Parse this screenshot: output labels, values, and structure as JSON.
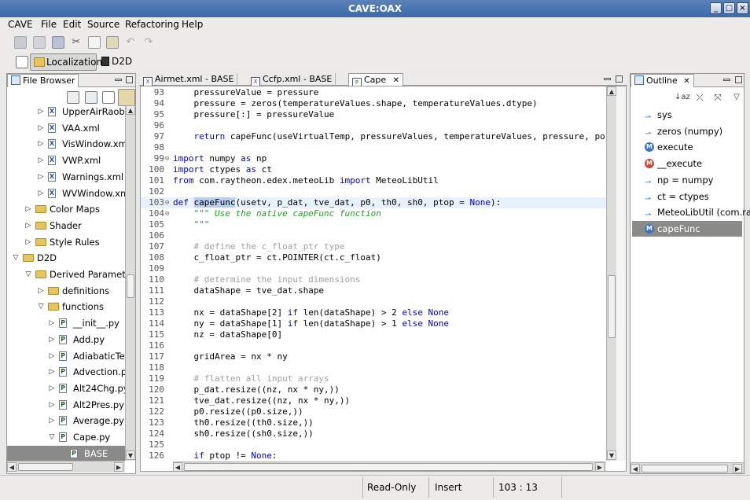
{
  "window": {
    "title": "CAVE:OAX"
  },
  "menu": [
    {
      "label": "CAVE"
    },
    {
      "label": "File"
    },
    {
      "label": "Edit"
    },
    {
      "label": "Source"
    },
    {
      "label": "Refactoring"
    },
    {
      "label": "Help"
    }
  ],
  "perspective": {
    "localization_label": "Localization",
    "d2d_label": "D2D"
  },
  "file_browser": {
    "tab_label": "File Browser",
    "rows": [
      {
        "label": "UpperAirRaob.x",
        "kind": "file",
        "depth": 3,
        "arrow": "right"
      },
      {
        "label": "VAA.xml",
        "kind": "file",
        "depth": 3,
        "arrow": "right"
      },
      {
        "label": "VisWindow.xml",
        "kind": "file",
        "depth": 3,
        "arrow": "right"
      },
      {
        "label": "VWP.xml",
        "kind": "file",
        "depth": 3,
        "arrow": "right"
      },
      {
        "label": "Warnings.xml",
        "kind": "file",
        "depth": 3,
        "arrow": "right"
      },
      {
        "label": "WVWindow.xml",
        "kind": "file",
        "depth": 3,
        "arrow": "right"
      },
      {
        "label": "Color Maps",
        "kind": "folder",
        "depth": 2,
        "arrow": "right"
      },
      {
        "label": "Shader",
        "kind": "folder",
        "depth": 2,
        "arrow": "right"
      },
      {
        "label": "Style Rules",
        "kind": "folder",
        "depth": 2,
        "arrow": "right"
      },
      {
        "label": "D2D",
        "kind": "folder",
        "depth": 1,
        "arrow": "down"
      },
      {
        "label": "Derived Parameter",
        "kind": "folder",
        "depth": 2,
        "arrow": "down"
      },
      {
        "label": "definitions",
        "kind": "folder",
        "depth": 3,
        "arrow": "right"
      },
      {
        "label": "functions",
        "kind": "folder",
        "depth": 3,
        "arrow": "down"
      },
      {
        "label": "__init__.py",
        "kind": "pyfile",
        "depth": 4,
        "arrow": "right"
      },
      {
        "label": "Add.py",
        "kind": "pyfile",
        "depth": 4,
        "arrow": "right"
      },
      {
        "label": "AdiabaticTem",
        "kind": "pyfile",
        "depth": 4,
        "arrow": "right"
      },
      {
        "label": "Advection.py",
        "kind": "pyfile",
        "depth": 4,
        "arrow": "right"
      },
      {
        "label": "Alt24Chg.py",
        "kind": "pyfile",
        "depth": 4,
        "arrow": "right"
      },
      {
        "label": "Alt2Pres.py",
        "kind": "pyfile",
        "depth": 4,
        "arrow": "right"
      },
      {
        "label": "Average.py",
        "kind": "pyfile",
        "depth": 4,
        "arrow": "right"
      },
      {
        "label": "Cape.py",
        "kind": "pyfile",
        "depth": 4,
        "arrow": "down"
      },
      {
        "label": "BASE",
        "kind": "pyfile",
        "depth": 5,
        "arrow": "",
        "selected": true
      }
    ]
  },
  "editor_tabs": [
    {
      "label": "Airmet.xml - BASE",
      "icon": "xml"
    },
    {
      "label": "Ccfp.xml - BASE",
      "icon": "xml"
    },
    {
      "label": "Cape",
      "icon": "py",
      "active": true
    }
  ],
  "code": {
    "lines": [
      {
        "n": "93",
        "t": "    pressureValue = pressure"
      },
      {
        "n": "94",
        "t": "    pressure = zeros(temperatureValues.shape, temperatureValues.dtype)"
      },
      {
        "n": "95",
        "t": "    pressure[:] = pressureValue"
      },
      {
        "n": "96",
        "t": ""
      },
      {
        "n": "97",
        "t": "    return capeFunc(useVirtualTemp, pressureValues, temperatureValues, pressure, po"
      },
      {
        "n": "98",
        "t": ""
      },
      {
        "n": "99",
        "t": "import numpy as np",
        "fold": true
      },
      {
        "n": "100",
        "t": "import ctypes as ct"
      },
      {
        "n": "101",
        "t": "from com.raytheon.edex.meteoLib import MeteoLibUtil"
      },
      {
        "n": "102",
        "t": ""
      },
      {
        "n": "103",
        "t": "def capeFunc(usetv, p_dat, tve_dat, p0, th0, sh0, ptop = None):",
        "fold": true,
        "current": true
      },
      {
        "n": "104",
        "t": "    \"\"\" Use the native capeFunc function",
        "fold": true
      },
      {
        "n": "105",
        "t": "    \"\"\""
      },
      {
        "n": "106",
        "t": ""
      },
      {
        "n": "107",
        "t": "    # define the c_float_ptr type"
      },
      {
        "n": "108",
        "t": "    c_float_ptr = ct.POINTER(ct.c_float)"
      },
      {
        "n": "109",
        "t": ""
      },
      {
        "n": "110",
        "t": "    # determine the input dimensions"
      },
      {
        "n": "111",
        "t": "    dataShape = tve_dat.shape"
      },
      {
        "n": "112",
        "t": ""
      },
      {
        "n": "113",
        "t": "    nx = dataShape[2] if len(dataShape) > 2 else None"
      },
      {
        "n": "114",
        "t": "    ny = dataShape[1] if len(dataShape) > 1 else None"
      },
      {
        "n": "115",
        "t": "    nz = dataShape[0]"
      },
      {
        "n": "116",
        "t": ""
      },
      {
        "n": "117",
        "t": "    gridArea = nx * ny"
      },
      {
        "n": "118",
        "t": ""
      },
      {
        "n": "119",
        "t": "    # flatten all input arrays"
      },
      {
        "n": "120",
        "t": "    p_dat.resize((nz, nx * ny,))"
      },
      {
        "n": "121",
        "t": "    tve_dat.resize((nz, nx * ny,))"
      },
      {
        "n": "122",
        "t": "    p0.resize((p0.size,))"
      },
      {
        "n": "123",
        "t": "    th0.resize((th0.size,))"
      },
      {
        "n": "124",
        "t": "    sh0.resize((sh0.size,))"
      },
      {
        "n": "125",
        "t": ""
      },
      {
        "n": "126",
        "t": "    if ptop != None:"
      }
    ]
  },
  "outline": {
    "tab_label": "Outline",
    "items": [
      {
        "label": "sys",
        "icon": "import"
      },
      {
        "label": "zeros (numpy)",
        "icon": "import"
      },
      {
        "label": "execute",
        "icon": "method"
      },
      {
        "label": "__execute",
        "icon": "private-method"
      },
      {
        "label": "np = numpy",
        "icon": "import"
      },
      {
        "label": "ct = ctypes",
        "icon": "import"
      },
      {
        "label": "MeteoLibUtil (com.ra",
        "icon": "import"
      },
      {
        "label": "capeFunc",
        "icon": "method",
        "selected": true
      }
    ]
  },
  "status": {
    "mode": "Read-Only",
    "insert": "Insert",
    "position": "103 : 13"
  },
  "colors": {
    "keyword": "#0000c0",
    "comment": "#a0a0a0",
    "docstring": "#20a020",
    "selection": "#8a8a88"
  }
}
